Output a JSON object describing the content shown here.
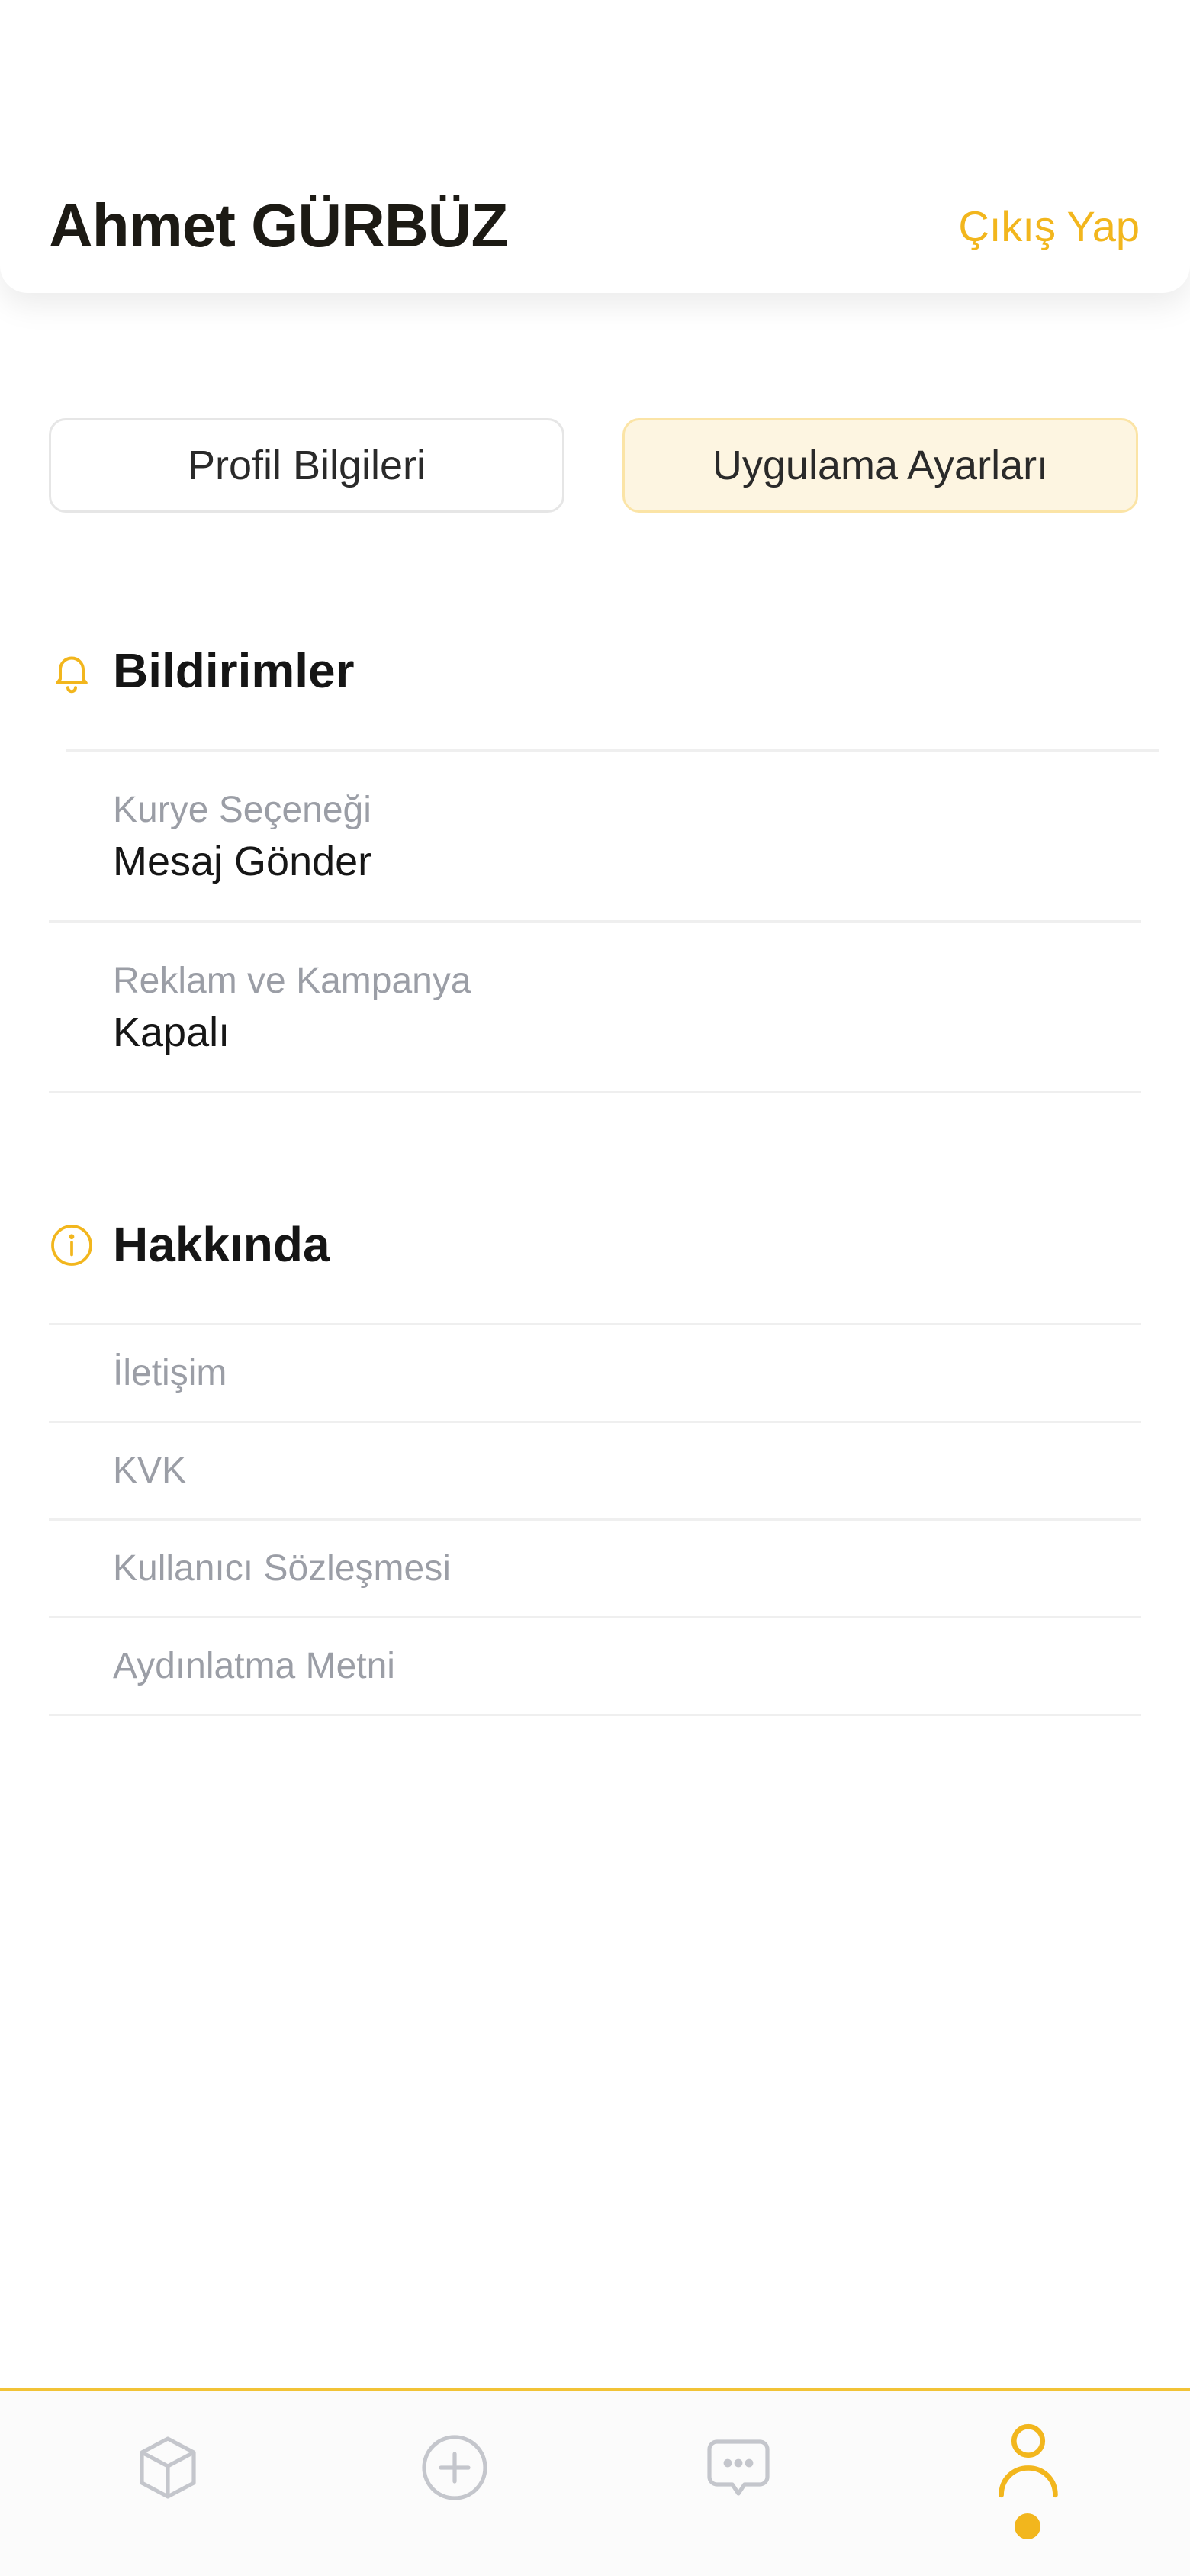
{
  "header": {
    "user_name": "Ahmet GÜRBÜZ",
    "logout_label": "Çıkış Yap"
  },
  "tabs": [
    {
      "label": "Profil Bilgileri",
      "active": false
    },
    {
      "label": "Uygulama Ayarları",
      "active": true
    }
  ],
  "notifications": {
    "title": "Bildirimler",
    "icon": "bell-icon",
    "items": [
      {
        "label": "Kurye Seçeneği",
        "value": "Mesaj Gönder"
      },
      {
        "label": "Reklam ve Kampanya",
        "value": "Kapalı"
      }
    ]
  },
  "about": {
    "title": "Hakkında",
    "icon": "info-icon",
    "items": [
      {
        "label": "İletişim"
      },
      {
        "label": "KVK"
      },
      {
        "label": "Kullanıcı Sözleşmesi"
      },
      {
        "label": "Aydınlatma Metni"
      }
    ]
  },
  "bottom_nav": {
    "items": [
      {
        "icon": "package-icon",
        "active": false
      },
      {
        "icon": "add-circle-icon",
        "active": false
      },
      {
        "icon": "chat-icon",
        "active": false
      },
      {
        "icon": "user-icon",
        "active": true
      }
    ]
  },
  "colors": {
    "accent": "#f2b61d",
    "active_tab_bg": "#fdf5e1",
    "muted_text": "#9b9ea6",
    "inactive_icon": "#c4c6cc"
  }
}
